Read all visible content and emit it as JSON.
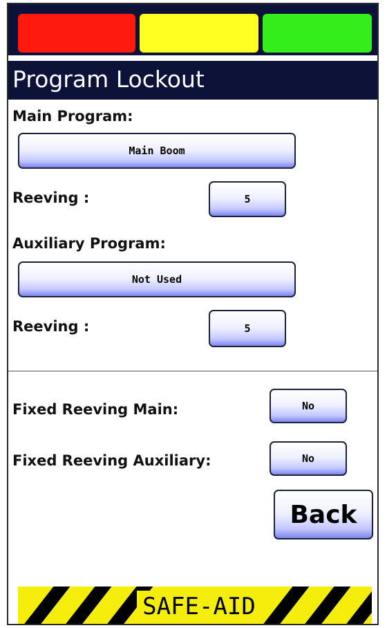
{
  "title": "Program Lockout",
  "main_program": {
    "label": "Main Program:",
    "value": "Main Boom"
  },
  "main_reeving": {
    "label": "Reeving :",
    "value": "5"
  },
  "aux_program": {
    "label": "Auxiliary Program:",
    "value": "Not Used"
  },
  "aux_reeving": {
    "label": "Reeving :",
    "value": "5"
  },
  "fixed_main": {
    "label": "Fixed Reeving Main:",
    "value": "No"
  },
  "fixed_aux": {
    "label": "Fixed Reeving Auxiliary:",
    "value": "No"
  },
  "back_label": "Back",
  "footer_brand": "SAFE-AID",
  "colors": {
    "red": "#ff1a10",
    "yellow": "#ffff22",
    "green": "#33ee1a",
    "navy": "#0c1238",
    "hazard_yellow": "#f5ee0c"
  }
}
